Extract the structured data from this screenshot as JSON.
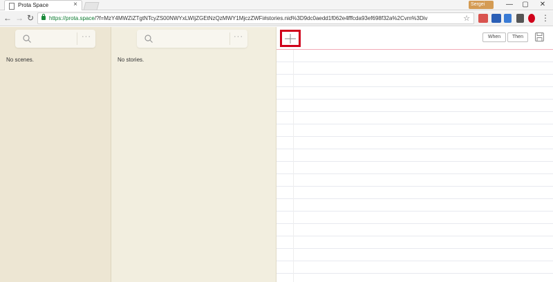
{
  "browser": {
    "tab_title": "Prota Space",
    "tab_close": "×",
    "profile_label": "Sergei",
    "url_host": "https://prota.space",
    "url_rest": "/?f=MzY4MWZiZTgtNTcyZS00NWYxLWIjZGEtNzQzMWY1MjczZWFi#stories.nid%3D9dc0aedd1f062e4fffcda93ef698f32a%2Cvm%3Div",
    "window_controls": {
      "minimize": "—",
      "maximize": "▢",
      "close": "✕"
    },
    "nav": {
      "back": "←",
      "forward": "→",
      "reload": "↻"
    },
    "bookmark_star": "☆",
    "menu": "⋮"
  },
  "scenes": {
    "search_placeholder": "",
    "more_label": "···",
    "empty_text": "No scenes."
  },
  "stories": {
    "search_placeholder": "",
    "more_label": "···",
    "empty_text": "No stories."
  },
  "editor": {
    "add_label": "+",
    "toggle_when": "When",
    "toggle_then": "Then"
  },
  "colors": {
    "accent_red": "#d0021b",
    "scenes_bg": "#ede6d3",
    "stories_bg": "#f2eedf"
  }
}
